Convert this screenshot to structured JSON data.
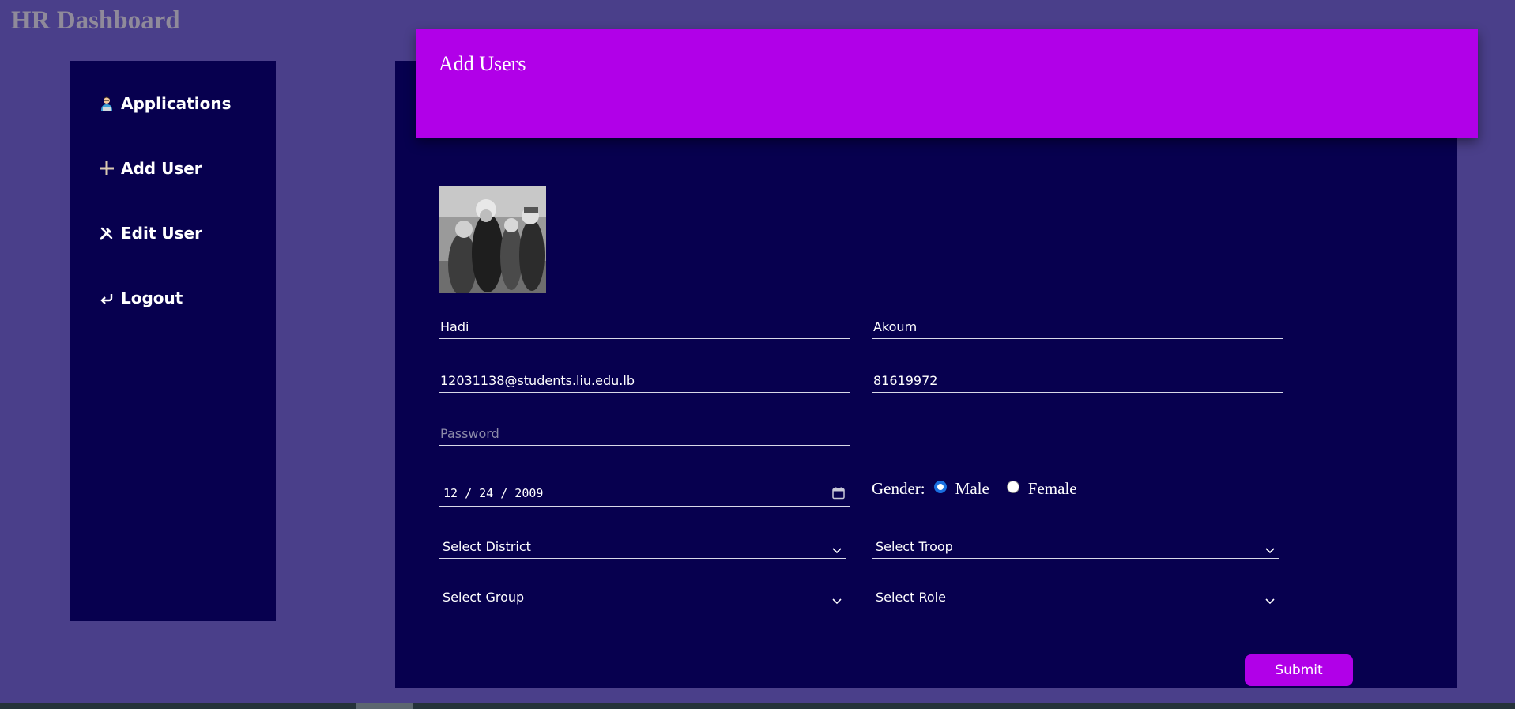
{
  "app": {
    "title": "HR Dashboard"
  },
  "sidebar": {
    "items": [
      {
        "label": "Applications",
        "icon": "person-laptop-icon"
      },
      {
        "label": "Add User",
        "icon": "plus-icon"
      },
      {
        "label": "Edit User",
        "icon": "tools-icon"
      },
      {
        "label": "Logout",
        "icon": "return-arrow-icon"
      }
    ]
  },
  "header": {
    "title": "Add Users"
  },
  "form": {
    "avatar": {
      "icon": "profile-photo"
    },
    "first_name": {
      "value": "Hadi"
    },
    "last_name": {
      "value": "Akoum"
    },
    "email": {
      "value": "12031138@students.liu.edu.lb"
    },
    "phone": {
      "value": "81619972"
    },
    "password": {
      "value": "",
      "placeholder": "Password"
    },
    "birthdate": {
      "month": "12",
      "day": "24",
      "year": "2009",
      "display": "12 / 24 / 2009"
    },
    "gender": {
      "label": "Gender:",
      "options": [
        "Male",
        "Female"
      ],
      "selected": "Male"
    },
    "district": {
      "selected": "Select District"
    },
    "troop": {
      "selected": "Select Troop"
    },
    "group": {
      "selected": "Select Group"
    },
    "role": {
      "selected": "Select Role"
    },
    "submit_label": "Submit"
  },
  "colors": {
    "page_bg": "#4a3f8a",
    "panel_bg": "#07004f",
    "accent": "#b100e8",
    "radio_checked": "#1a6fe0"
  }
}
